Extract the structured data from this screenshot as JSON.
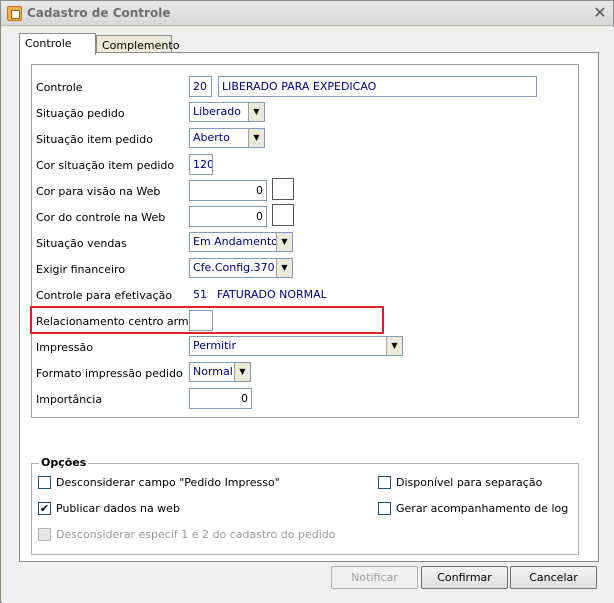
{
  "window": {
    "title": "Cadastro de Controle",
    "close_glyph": "✕"
  },
  "tabs": [
    {
      "label": "Controle",
      "active": true
    },
    {
      "label": "Complemento",
      "active": false
    }
  ],
  "form": {
    "controle": {
      "label": "Controle",
      "code": "20",
      "description": "LIBERADO PARA EXPEDICAO"
    },
    "situacao_pedido": {
      "label": "Situação pedido",
      "value": "Liberado"
    },
    "situacao_item_pedido": {
      "label": "Situação item pedido",
      "value": "Aberto"
    },
    "cor_situacao_item_pedido": {
      "label": "Cor situação item pedido",
      "value": "120"
    },
    "cor_visao_web": {
      "label": "Cor para visão na Web",
      "value": "0"
    },
    "cor_controle_web": {
      "label": "Cor do controle na Web",
      "value": "0"
    },
    "situacao_vendas": {
      "label": "Situação vendas",
      "value": "Em Andamento"
    },
    "exigir_financeiro": {
      "label": "Exigir financeiro",
      "value": "Cfe.Config.370"
    },
    "controle_efetivacao": {
      "label": "Controle para efetivação",
      "code": "51",
      "description": "FATURADO NORMAL"
    },
    "relacionamento_centro": {
      "label": "Relacionamento centro armaz.",
      "value": ""
    },
    "impressao": {
      "label": "Impressão",
      "value": "Permitir"
    },
    "formato_impressao": {
      "label": "Formato impressão pedido",
      "value": "Normal"
    },
    "importancia": {
      "label": "Importância",
      "value": "0"
    }
  },
  "opcoes": {
    "title": "Opções",
    "items": [
      {
        "label": "Desconsiderar campo \"Pedido Impresso\"",
        "checked": false,
        "enabled": true
      },
      {
        "label": "Disponível para separação",
        "checked": false,
        "enabled": true
      },
      {
        "label": "Publicar dados na web",
        "checked": true,
        "enabled": true
      },
      {
        "label": "Gerar acompanhamento de log",
        "checked": false,
        "enabled": true
      },
      {
        "label": "Desconsiderar especif 1 e 2 do cadastro do pedido",
        "checked": false,
        "enabled": false
      }
    ]
  },
  "buttons": {
    "notificar": "Notificar",
    "confirmar": "Confirmar",
    "cancelar": "Cancelar"
  },
  "icons": {
    "dropdown_arrow": "▼",
    "check_mark": "✔"
  },
  "colors": {
    "highlight_border": "#d9242a",
    "field_text": "#00007f"
  }
}
